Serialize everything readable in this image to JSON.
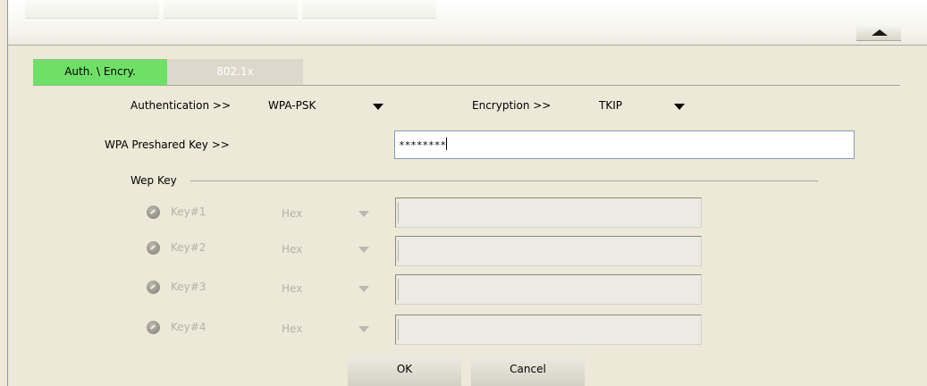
{
  "top_tabs": [
    "",
    "",
    ""
  ],
  "dialog": {
    "tabs": [
      {
        "label": "Auth. \\ Encry.",
        "active": true
      },
      {
        "label": "802.1x",
        "active": false
      }
    ],
    "authentication": {
      "label": "Authentication >>",
      "value": "WPA-PSK"
    },
    "encryption": {
      "label": "Encryption >>",
      "value": "TKIP"
    },
    "preshared_key": {
      "label": "WPA Preshared Key >>",
      "value": "********"
    },
    "wep_key": {
      "group_label": "Wep Key",
      "keys": [
        {
          "label": "Key#1",
          "format": "Hex",
          "value": ""
        },
        {
          "label": "Key#2",
          "format": "Hex",
          "value": ""
        },
        {
          "label": "Key#3",
          "format": "Hex",
          "value": ""
        },
        {
          "label": "Key#4",
          "format": "Hex",
          "value": ""
        }
      ]
    },
    "buttons": {
      "ok": "OK",
      "cancel": "Cancel"
    }
  },
  "colors": {
    "active_tab": "#6fe066",
    "background": "#ece9d8",
    "disabled_text": "#b4b2a9"
  }
}
